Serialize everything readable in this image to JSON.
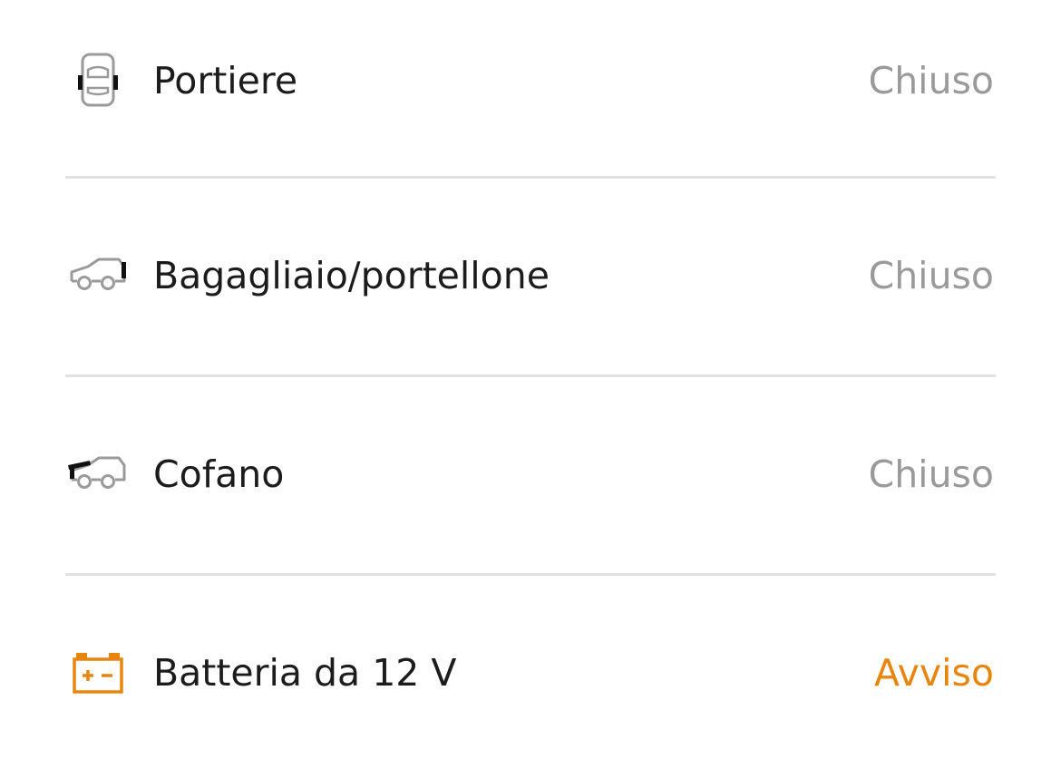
{
  "colors": {
    "label": "#1c1c1c",
    "status_ok": "#9a9a9a",
    "status_warning": "#e8850f",
    "icon_gray": "#9a9a9a",
    "icon_highlight": "#111111",
    "divider": "#e1e1e1"
  },
  "rows": [
    {
      "icon": "car-doors-icon",
      "label": "Portiere",
      "status": "Chiuso",
      "status_type": "ok"
    },
    {
      "icon": "car-tailgate-icon",
      "label": "Bagagliaio/portellone",
      "status": "Chiuso",
      "status_type": "ok"
    },
    {
      "icon": "car-hood-icon",
      "label": "Cofano",
      "status": "Chiuso",
      "status_type": "ok"
    },
    {
      "icon": "battery-icon",
      "label": "Batteria da 12 V",
      "status": "Avviso",
      "status_type": "warning"
    }
  ]
}
